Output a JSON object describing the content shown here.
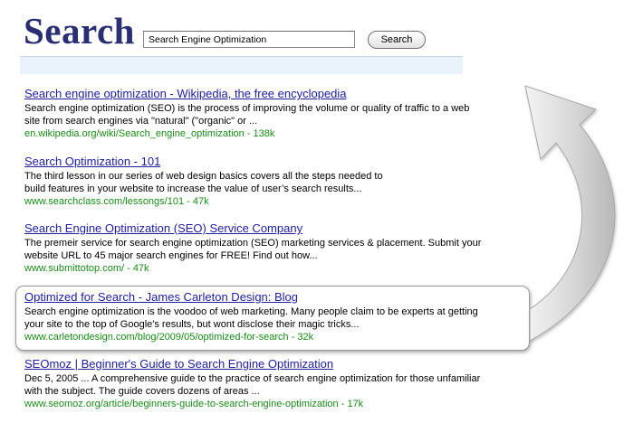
{
  "logo": "Search",
  "search": {
    "value": "Search Engine Optimization",
    "button_label": "Search"
  },
  "results": [
    {
      "title": "Search engine optimization - Wikipedia, the free encyclopedia",
      "snippet": [
        "Search engine optimization (SEO) is the process of improving the volume or quality of traffic to a web",
        "site from search engines via \"natural\" (\"organic\" or ..."
      ],
      "url": "en.wikipedia.org/wiki/Search_engine_optimization - 138k"
    },
    {
      "title": "Search Optimization - 101",
      "snippet": [
        "The third lesson in our series of web design basics covers all the steps needed to",
        "build features in your website to increase the value of user’s search results..."
      ],
      "url": "www.searchclass.com/lessongs/101 - 47k"
    },
    {
      "title": "Search Engine Optimization (SEO) Service Company",
      "snippet": [
        "The premeir service for search engine optimization (SEO) marketing services & placement. Submit your",
        "website URL to 45 major search engines for FREE! Find out how..."
      ],
      "url": "www.submittotop.com/ - 47k"
    },
    {
      "title": "Optimized for Search - James Carleton Design: Blog",
      "snippet": [
        "Search engine optimization is the voodoo of web marketing. Many people claim to be experts at getting",
        "your site to the top of Google's results, but wont disclose their magic tricks..."
      ],
      "url": "www.carletondesign.com/blog/2009/05/optimized-for-search - 32k"
    },
    {
      "title": "SEOmoz | Beginner's Guide to Search Engine Optimization",
      "snippet": [
        "Dec 5, 2005 ... A comprehensive guide to the practice of search engine optimization for those unfamiliar",
        "with the subject. The guide covers dozens of areas ..."
      ],
      "url": "www.seomoz.org/article/beginners-guide-to-search-engine-optimization - 17k"
    }
  ],
  "colors": {
    "logo": "#2a2e72",
    "link": "#2020a0",
    "url": "#1a8a1a",
    "header_bar": "#eaf2fb"
  },
  "icons": {
    "arrow": "curved-arrow-icon"
  }
}
